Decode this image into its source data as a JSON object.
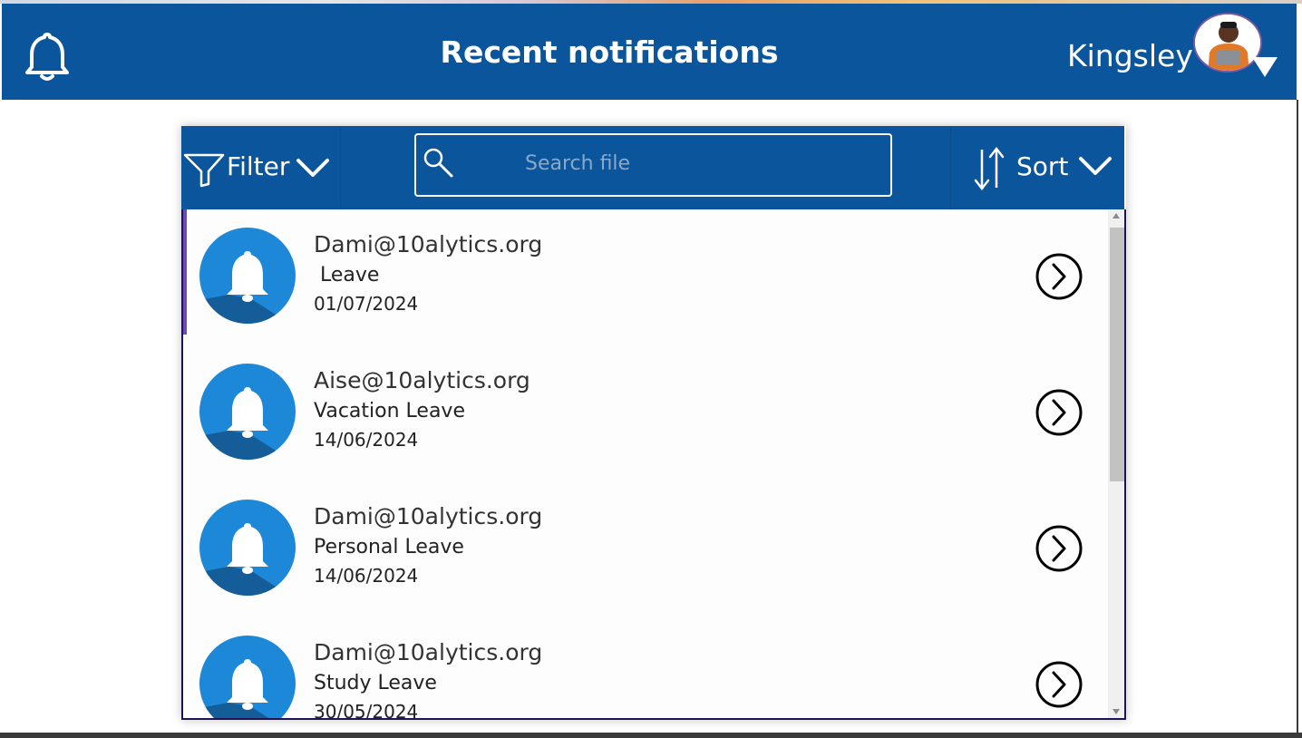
{
  "header": {
    "title": "Recent notifications",
    "user_name": "Kingsley",
    "bell_icon": "bell-icon",
    "avatar": "user-avatar-photo",
    "avatar_dropdown_icon": "caret-down-icon"
  },
  "toolbar": {
    "filter_label": "Filter",
    "filter_icon": "funnel-icon",
    "search_placeholder": "Search file",
    "search_icon": "magnifier-icon",
    "sort_label": "Sort",
    "sort_icon": "sort-arrows-icon"
  },
  "notifications": [
    {
      "email": "Dami@10alytics.org",
      "type": " Leave",
      "date": "01/07/2024",
      "selected": true
    },
    {
      "email": "Aise@10alytics.org",
      "type": "Vacation Leave",
      "date": "14/06/2024",
      "selected": false
    },
    {
      "email": "Dami@10alytics.org",
      "type": "Personal Leave",
      "date": "14/06/2024",
      "selected": false
    },
    {
      "email": "Dami@10alytics.org",
      "type": "Study Leave",
      "date": "30/05/2024",
      "selected": false
    }
  ],
  "colors": {
    "header_bg": "#0b559c",
    "accent_blue": "#1e88d8",
    "selected_bar": "#6a4bb0"
  }
}
